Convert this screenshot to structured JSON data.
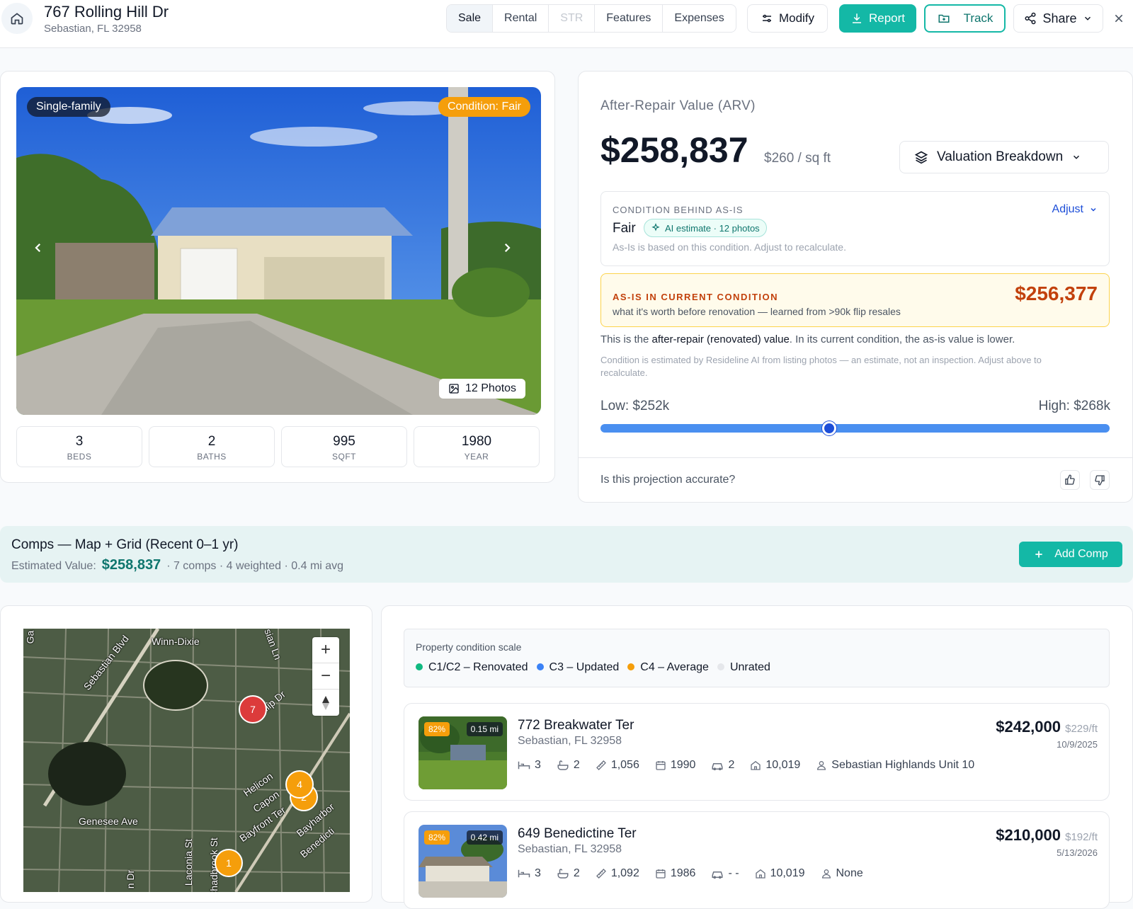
{
  "header": {
    "address": "767 Rolling Hill Dr",
    "city": "Sebastian, FL 32958",
    "tabs": [
      "Sale",
      "Rental",
      "STR",
      "Features",
      "Expenses"
    ],
    "modify": "Modify",
    "report": "Report",
    "track": "Track",
    "share": "Share"
  },
  "photo": {
    "type": "Single-family",
    "condition": "Condition: Fair",
    "photos": "12 Photos"
  },
  "stats": [
    {
      "v": "3",
      "l": "BEDS"
    },
    {
      "v": "2",
      "l": "BATHS"
    },
    {
      "v": "995",
      "l": "SQFT"
    },
    {
      "v": "1980",
      "l": "YEAR"
    }
  ],
  "arv": {
    "label": "After-Repair Value (ARV)",
    "price": "$258,837",
    "per_sqft": "$260 / sq ft",
    "breakdown": "Valuation Breakdown",
    "cond_label": "CONDITION BEHIND AS-IS",
    "cond": "Fair",
    "ai": "AI estimate · 12 photos",
    "adjust": "Adjust",
    "cond_note": "As-Is is based on this condition. Adjust to recalculate.",
    "asis_label": "AS-IS IN CURRENT CONDITION",
    "asis_note": "what it's worth before renovation — learned from >90k flip resales",
    "asis_price": "$256,377",
    "note1a": "This is the ",
    "note1b": "after-repair (renovated) value",
    "note1c": ". In its current condition, the as-is value is lower.",
    "note2": "Condition is estimated by Resideline AI from listing photos — an estimate, not an inspection. Adjust above to recalculate.",
    "low": "Low: $252k",
    "high": "High: $268k",
    "accurate": "Is this projection accurate?"
  },
  "comps": {
    "title": "Comps — Map + Grid (Recent 0–1 yr)",
    "est_label": "Estimated Value:",
    "est": "$258,837",
    "meta": "· 7 comps · 4 weighted · 0.4 mi avg",
    "add": "Add Comp"
  },
  "map": {
    "labels": [
      "Winn-Dixie",
      "Sebastian Blvd",
      "Tulip Dr",
      "Genesee Ave",
      "Helicon",
      "Capon",
      "Bayfront Ter",
      "Bayharbor",
      "Laconia St",
      "Benedicti",
      "Ga",
      "sian Ln",
      "Chadbrook St",
      "n Dr"
    ],
    "pins": [
      "7",
      "4",
      "2",
      "1"
    ]
  },
  "scale": {
    "title": "Property condition scale",
    "items": [
      "C1/C2 – Renovated",
      "C3 – Updated",
      "C4 – Average",
      "Unrated"
    ],
    "colors": [
      "#10b981",
      "#3b82f6",
      "#f59e0b",
      "#e5e7eb"
    ]
  },
  "comp_list": [
    {
      "pct": "82%",
      "dist": "0.15 mi",
      "title": "772 Breakwater Ter",
      "city": "Sebastian, FL 32958",
      "price": "$242,000",
      "pft": "$229/ft",
      "date": "10/9/2025",
      "beds": "3",
      "baths": "2",
      "sqft": "1,056",
      "year": "1990",
      "garage": "2",
      "lot": "10,019",
      "sub": "Sebastian Highlands Unit 10"
    },
    {
      "pct": "82%",
      "dist": "0.42 mi",
      "title": "649 Benedictine Ter",
      "city": "Sebastian, FL 32958",
      "price": "$210,000",
      "pft": "$192/ft",
      "date": "5/13/2026",
      "beds": "3",
      "baths": "2",
      "sqft": "1,092",
      "year": "1986",
      "garage": "- -",
      "lot": "10,019",
      "sub": "None"
    }
  ]
}
